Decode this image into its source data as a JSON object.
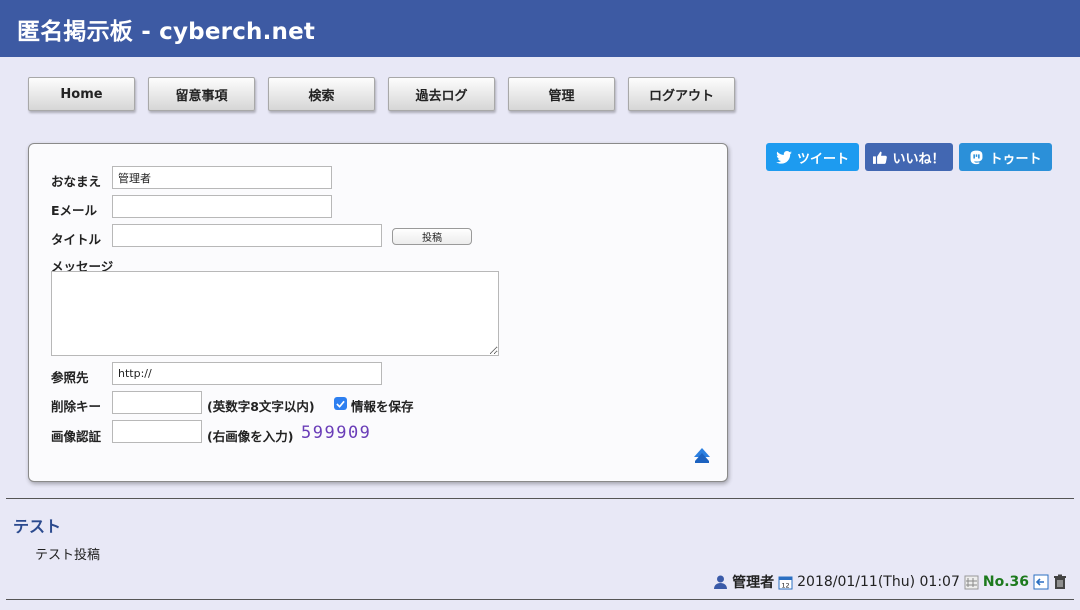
{
  "header": {
    "title": "匿名掲示板 - cyberch.net"
  },
  "nav": {
    "items": [
      {
        "label": "Home"
      },
      {
        "label": "留意事項"
      },
      {
        "label": "検索"
      },
      {
        "label": "過去ログ"
      },
      {
        "label": "管理"
      },
      {
        "label": "ログアウト"
      }
    ]
  },
  "share": {
    "tweet": "ツイート",
    "like": "いいね！",
    "toot": "トゥート"
  },
  "form": {
    "name_label": "おなまえ",
    "name_value": "管理者",
    "email_label": "Eメール",
    "email_value": "",
    "title_label": "タイトル",
    "title_value": "",
    "submit_label": "投稿",
    "message_label": "メッセージ",
    "message_value": "",
    "url_label": "参照先",
    "url_value": "http://",
    "delkey_label": "削除キー",
    "delkey_value": "",
    "delkey_note": "(英数字8文字以内)",
    "save_label": "情報を保存",
    "save_checked": true,
    "captcha_label": "画像認証",
    "captcha_value": "",
    "captcha_note": "(右画像を入力)",
    "captcha_code": "599909"
  },
  "post": {
    "title": "テスト",
    "body": "テスト投稿",
    "author": "管理者",
    "datetime": "2018/01/11(Thu) 01:07",
    "number": "No.36"
  },
  "colors": {
    "header": "#3d5aa3",
    "tweet": "#1d9bf0",
    "like": "#4267b2",
    "toot": "#2b90d9"
  }
}
